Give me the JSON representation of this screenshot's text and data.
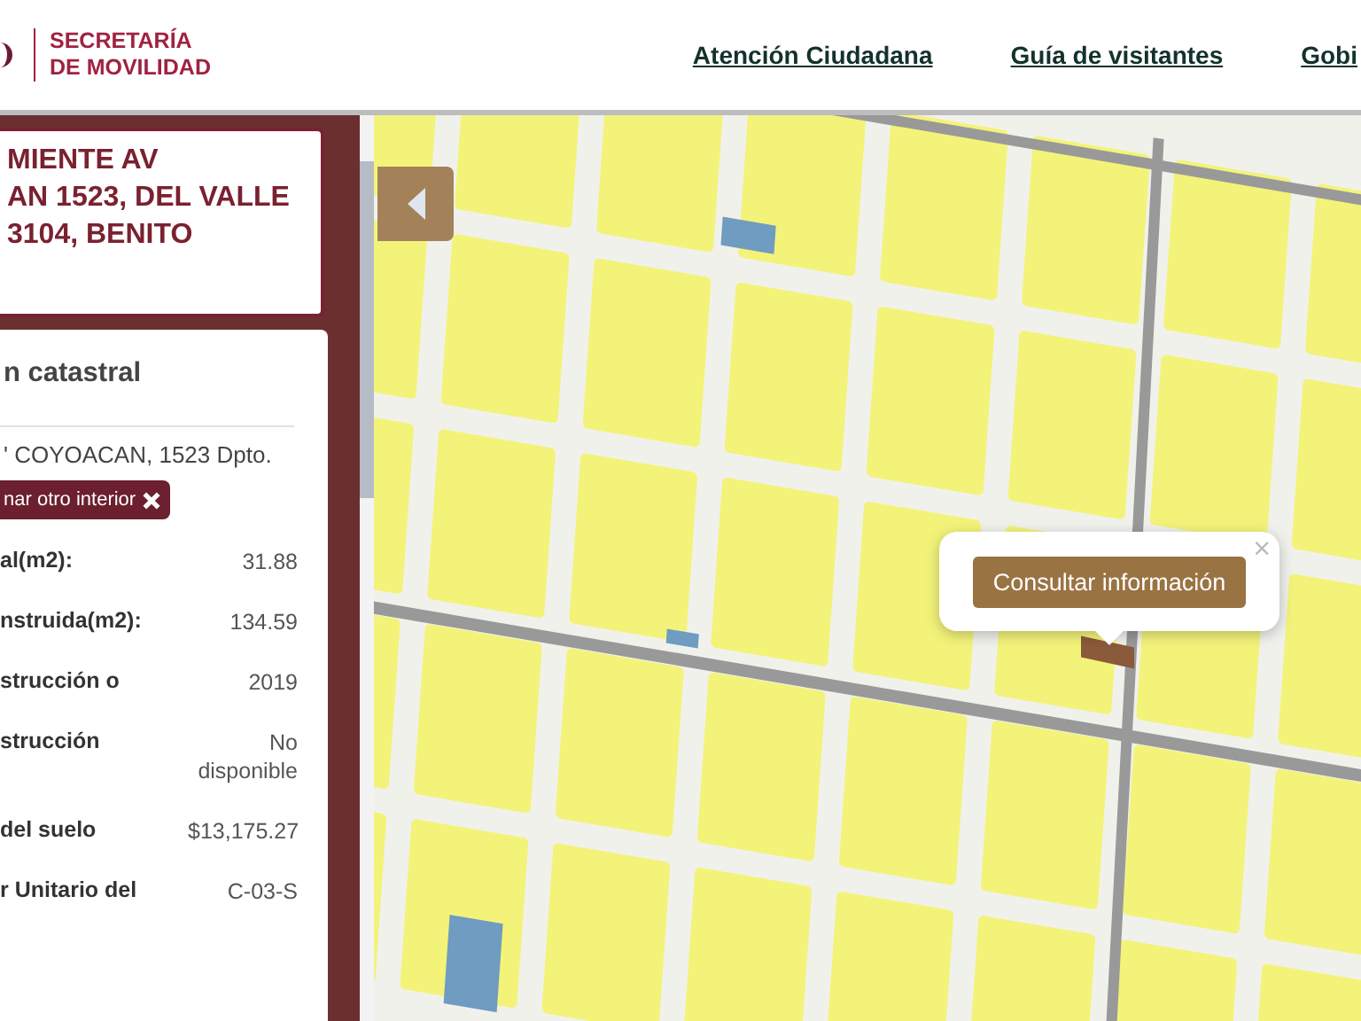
{
  "header": {
    "logo_lines": [
      "SECRETARÍA",
      "DE MOVILIDAD"
    ],
    "nav_links": [
      "Atención Ciudadana",
      "Guía de visitantes",
      "Gobi"
    ]
  },
  "address_card": {
    "lines": [
      "MIENTE AV",
      "AN 1523, DEL VALLE",
      "3104, BENITO"
    ]
  },
  "info_card": {
    "title": "n catastral",
    "address": "' COYOACAN, 1523 Dpto.",
    "clear_button": "nar otro interior",
    "rows": [
      {
        "label": "al(m2):",
        "value": "31.88"
      },
      {
        "label": "nstruida(m2):",
        "value": "134.59"
      },
      {
        "label": "strucción o",
        "value": "2019"
      },
      {
        "label": "strucción",
        "value": "No disponible"
      },
      {
        "label": "del suelo",
        "value": "$13,175.27"
      },
      {
        "label": "r Unitario del",
        "value": "C-03-S"
      }
    ]
  },
  "map": {
    "popup": {
      "button": "Consultar información",
      "close": "×"
    }
  }
}
